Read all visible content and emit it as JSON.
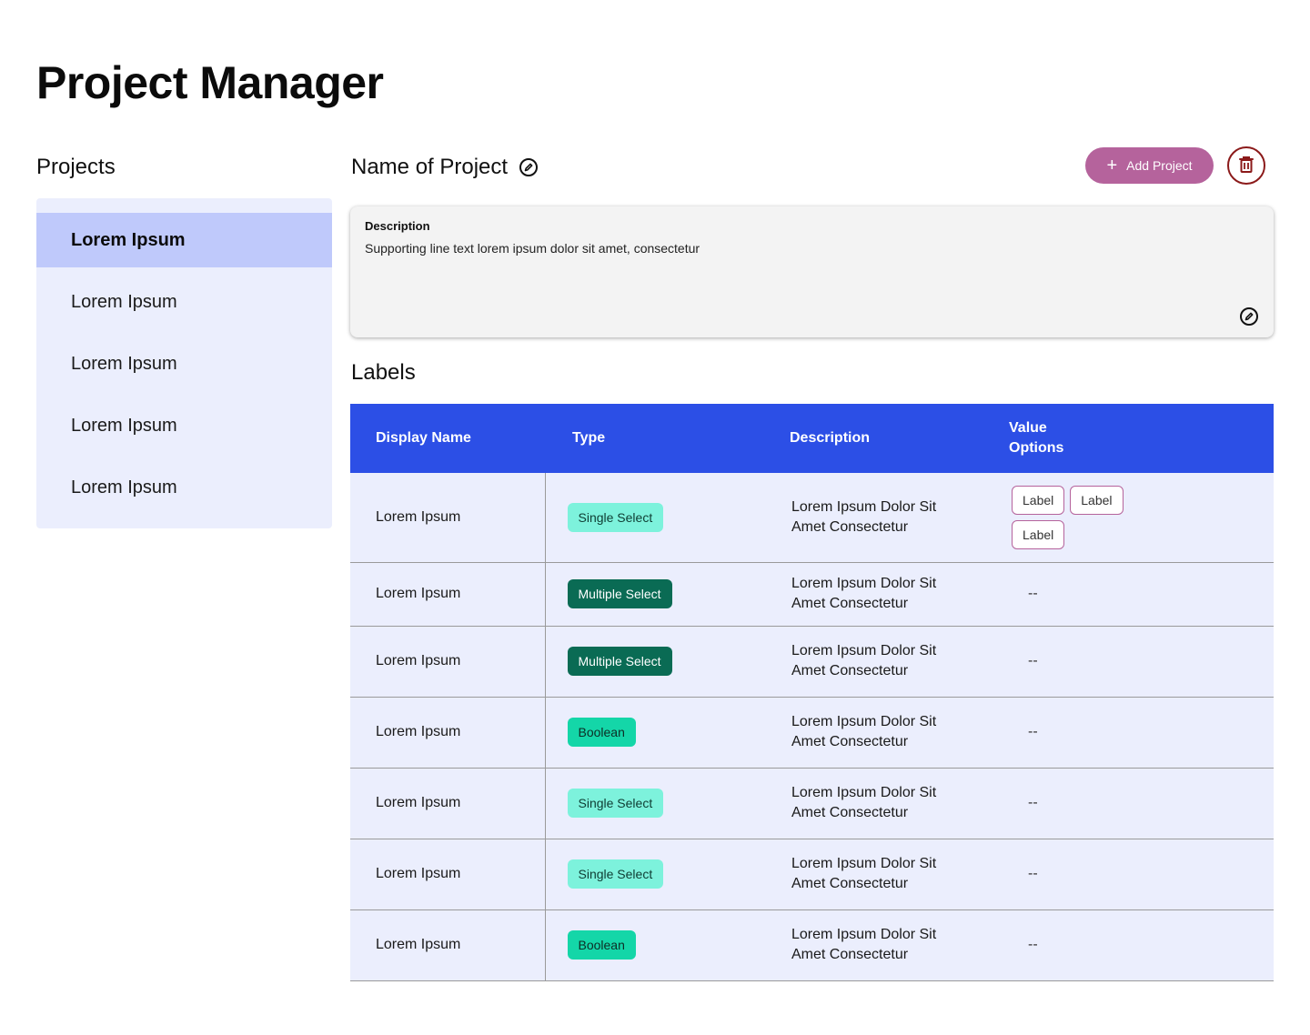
{
  "app": {
    "title": "Project Manager"
  },
  "sidebar": {
    "heading": "Projects",
    "items": [
      {
        "label": "Lorem Ipsum",
        "active": true
      },
      {
        "label": "Lorem Ipsum"
      },
      {
        "label": "Lorem Ipsum"
      },
      {
        "label": "Lorem Ipsum"
      },
      {
        "label": "Lorem Ipsum"
      }
    ]
  },
  "project": {
    "name": "Name of Project",
    "edit_icon": "edit-circle-icon",
    "add_button_label": "Add Project",
    "add_button_icon": "plus-icon",
    "delete_icon": "trash-icon",
    "description_label": "Description",
    "description_text": "Supporting line text lorem ipsum dolor sit amet, consectetur"
  },
  "labels": {
    "heading": "Labels",
    "columns": {
      "display_name": "Display Name",
      "type": "Type",
      "description": "Description",
      "value_options": "Value Options"
    },
    "rows": [
      {
        "name": "Lorem Ipsum",
        "type": "Single Select",
        "description": "Lorem Ipsum Dolor Sit Amet Consectetur",
        "values": [
          "Label",
          "Label",
          "Label"
        ]
      },
      {
        "name": "Lorem Ipsum",
        "type": "Multiple Select",
        "description": "Lorem Ipsum Dolor Sit Amet Consectetur",
        "values": "--"
      },
      {
        "name": "Lorem Ipsum",
        "type": "Multiple Select",
        "description": "Lorem Ipsum Dolor Sit Amet Consectetur",
        "values": "--"
      },
      {
        "name": "Lorem Ipsum",
        "type": "Boolean",
        "description": "Lorem Ipsum Dolor Sit Amet Consectetur",
        "values": "--"
      },
      {
        "name": "Lorem Ipsum",
        "type": "Single Select",
        "description": "Lorem Ipsum Dolor Sit Amet Consectetur",
        "values": "--"
      },
      {
        "name": "Lorem Ipsum",
        "type": "Single Select",
        "description": "Lorem Ipsum Dolor Sit Amet Consectetur",
        "values": "--"
      },
      {
        "name": "Lorem Ipsum",
        "type": "Boolean",
        "description": "Lorem Ipsum Dolor Sit Amet Consectetur",
        "values": "--"
      }
    ]
  },
  "colors": {
    "header_blue": "#2c4fe6",
    "sidebar_bg": "#ebeefd",
    "sidebar_active": "#bfc9fb",
    "add_button": "#b5639c",
    "delete_border": "#8b1a1a",
    "chip_single": "#7df2dc",
    "chip_multiple": "#0a6b54",
    "chip_boolean": "#14d6a8"
  }
}
